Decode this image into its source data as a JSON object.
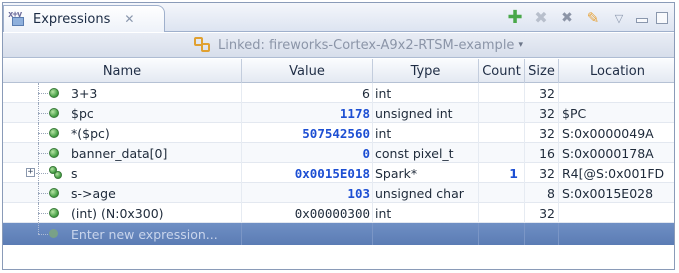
{
  "view": {
    "tab_title": "Expressions",
    "tab_close": "✕",
    "toolbar": {
      "add_icon": "add-expression-icon",
      "remove_icon": "remove-expression-icon",
      "remove_all_icon": "remove-all-icon",
      "pin_icon": "pin-icon",
      "menu_icon": "view-menu-icon"
    }
  },
  "linked": {
    "label": "Linked: fireworks-Cortex-A9x2-RTSM-example",
    "caret": "▾"
  },
  "columns": {
    "name": "Name",
    "value": "Value",
    "type": "Type",
    "count": "Count",
    "size": "Size",
    "location": "Location"
  },
  "rows": [
    {
      "name": "3+3",
      "value": "6",
      "type": "int",
      "count": "",
      "size": "32",
      "location": ""
    },
    {
      "name": "$pc",
      "value": "1178",
      "type": "unsigned int",
      "count": "",
      "size": "32",
      "location": "$PC"
    },
    {
      "name": "*($pc)",
      "value": "507542560",
      "type": "int",
      "count": "",
      "size": "32",
      "location": "S:0x0000049A"
    },
    {
      "name": "banner_data[0]",
      "value": "0",
      "type": "const pixel_t",
      "count": "",
      "size": "16",
      "location": "S:0x0000178A"
    },
    {
      "name": "s",
      "value": "0x0015E018",
      "type": "Spark*",
      "count": "1",
      "size": "32",
      "location": "R4[@S:0x001FD"
    },
    {
      "name": "s->age",
      "value": "103",
      "type": "unsigned char",
      "count": "",
      "size": "8",
      "location": "S:0x0015E028"
    },
    {
      "name": "(int) (N:0x300)",
      "value": "0x00000300",
      "type": "int",
      "count": "",
      "size": "32",
      "location": ""
    }
  ],
  "new_expression": {
    "placeholder": "Enter new expression..."
  },
  "colors": {
    "value_highlight": "#1d4fd3",
    "new_row_bg": "#5b7cb4",
    "icon_green": "#3f9b3f"
  }
}
